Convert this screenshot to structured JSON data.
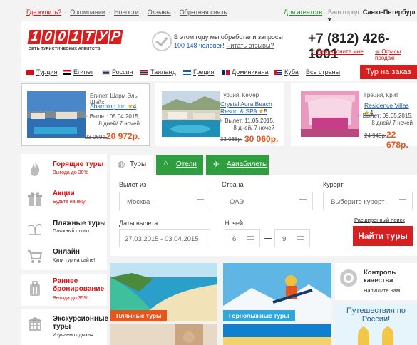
{
  "topbar": {
    "links": [
      "Где купить?",
      "О компании",
      "Новости",
      "Отзывы",
      "Обратная связь"
    ],
    "agents": "Для агентств",
    "city_label": "Ваш город:",
    "city_value": "Санкт-Петербург ▾"
  },
  "header": {
    "logo_chars": [
      "1",
      "0",
      "0",
      "1",
      "Т",
      "У",
      "Р"
    ],
    "logo_sub": "СЕТЬ ТУРИСТИЧЕСКИХ АГЕНТСТВ",
    "requests_line1": "В этом году мы обработали запросы",
    "requests_count": "100 148 человек!",
    "requests_link": "Читать отзывы?",
    "phone": "+7 (812) 426-1001",
    "callback": "Перезвоните мне",
    "offices": "Офисы продаж"
  },
  "countries": {
    "items": [
      "Турция",
      "Египет",
      "Россия",
      "Таиланд",
      "Греция",
      "Доминикана",
      "Куба"
    ],
    "all": "Все страны",
    "order_button": "Тур на заказ"
  },
  "offers": [
    {
      "location": "Египет, Шарм Эль Шейх",
      "hotel": "Sharming Inn",
      "stars": "4",
      "depart": "Вылет: 05.04.2015,",
      "nights": "8 дней/ 7 ночей",
      "old_price": "23 069р.",
      "new_price": "20 972р."
    },
    {
      "location": "Турция, Кемер",
      "hotel": "Crystal Aura Beach Resort & SPA",
      "stars": "5",
      "depart": "Вылет: 11.05.2015,",
      "nights": "8 дней/ 7 ночей",
      "old_price": "33 066р.",
      "new_price": "30 060р."
    },
    {
      "location": "Греция, Крит",
      "hotel": "Residence Villas",
      "stars": "4",
      "depart": "Вылет: 09.05.2015,",
      "nights": "8 дней/ 7 ночей",
      "old_price": "24 945р.",
      "new_price": "22 678р."
    }
  ],
  "sidebar": [
    {
      "title": "Горящие туры",
      "sub": "Выгода до 30%",
      "icon": "fire-icon"
    },
    {
      "title": "Акции",
      "sub": "Будьте начеку!",
      "icon": "gift-icon"
    },
    {
      "title": "Пляжные туры",
      "sub": "Пляжный отдых",
      "icon": "palm-icon"
    },
    {
      "title": "Онлайн",
      "sub": "Купи тур на сайте!",
      "icon": "cart-icon"
    },
    {
      "title": "Раннее бронирование",
      "sub": "Выгода до 35%",
      "icon": "suitcase-icon"
    },
    {
      "title": "Экскурсионные туры",
      "sub": "Изучаем отдыхая",
      "icon": "building-icon"
    }
  ],
  "search": {
    "tabs": [
      "Туры",
      "Отели",
      "Авиабилеты"
    ],
    "depart_label": "Вылет из",
    "depart_value": "Москва",
    "country_label": "Страна",
    "country_value": "ОАЭ",
    "resort_label": "Курорт",
    "resort_placeholder": "Выберите курорт",
    "dates_label": "Даты вылета",
    "dates_value": "27.03.2015 - 03.04.2015",
    "nights_label": "Ночей",
    "nights_from": "6",
    "nights_to": "9",
    "advanced": "Расширенный поиск",
    "find_button": "Найти туры"
  },
  "tiles": [
    "Пляжные туры",
    "Горнолыжные туры"
  ],
  "quality": {
    "title": "Контроль качества",
    "sub": "Напишите нам"
  },
  "trips": {
    "title": "Путешествия по России!"
  },
  "colors": {
    "brand_red": "#d71f1f",
    "green": "#2f9e3f",
    "orange_price": "#e8541a",
    "link": "#1a5fb4"
  }
}
